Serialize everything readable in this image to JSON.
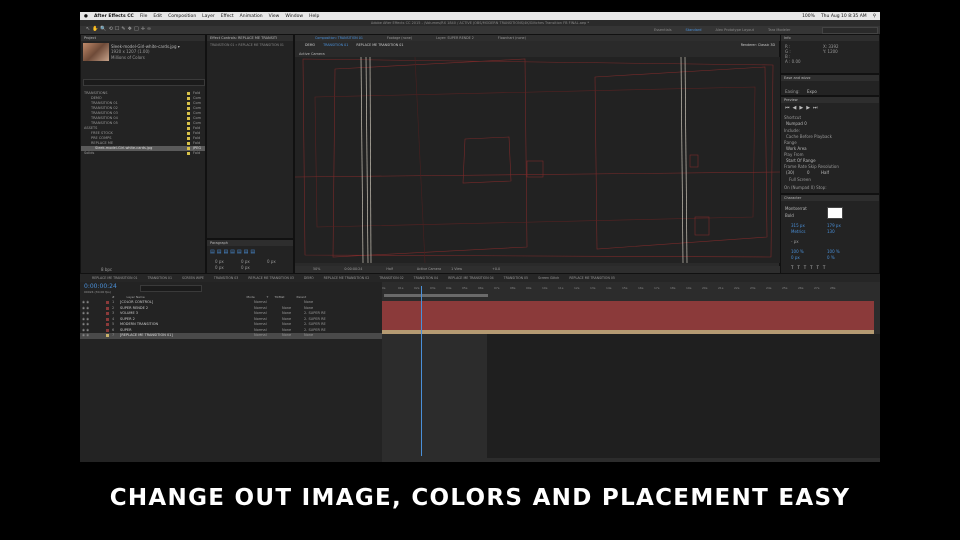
{
  "menu": [
    "After Effects CC",
    "File",
    "Edit",
    "Composition",
    "Layer",
    "Effect",
    "Animation",
    "View",
    "Window",
    "Help"
  ],
  "status": {
    "battery": "100%",
    "time": "Thu Aug 10  8:35 AM"
  },
  "window_title": "Adobe After Effects CC 2015 - /Volumes/RX 1840 / ACTIVE JOBS/MODERN TRANSITIONS/4K/Glitches Transition FB FINAL.aep *",
  "workspaces": [
    "Essentials",
    "Standard",
    "Alex Prototype Layout",
    "Tara Modeler"
  ],
  "project": {
    "title": "Project",
    "filename": "Sleek-model-Girl-white-cards.jpg ▾",
    "dims": "1920 x 1207 (1.00)",
    "colors": "Millions of Colors",
    "items": [
      {
        "name": "TRANSITIONS",
        "type": "Fold",
        "sel": false
      },
      {
        "name": "DEMO",
        "type": "Com",
        "sel": false
      },
      {
        "name": "TRANSITION 01",
        "type": "Com",
        "sel": false
      },
      {
        "name": "TRANSITION 02",
        "type": "Com",
        "sel": false
      },
      {
        "name": "TRANSITION 03",
        "type": "Com",
        "sel": false
      },
      {
        "name": "TRANSITION 04",
        "type": "Com",
        "sel": false
      },
      {
        "name": "TRANSITION 05",
        "type": "Com",
        "sel": false
      },
      {
        "name": "ASSETS",
        "type": "Fold",
        "sel": false
      },
      {
        "name": "FREE STOCK",
        "type": "Fold",
        "sel": false
      },
      {
        "name": "PRE COMPS",
        "type": "Fold",
        "sel": false
      },
      {
        "name": "REPLACE ME",
        "type": "Fold",
        "sel": false
      },
      {
        "name": "Sleek-model-Girl-white-cards.jpg",
        "type": "JPEG",
        "sel": true
      },
      {
        "name": "Solids",
        "type": "Fold",
        "sel": false
      }
    ],
    "footer": "8 bpc"
  },
  "effect_controls": {
    "title": "Effect Controls: REPLACE ME TRANSITI",
    "sub": "TRANSITION 01 » REPLACE ME TRANSITION 01"
  },
  "paragraph": {
    "title": "Paragraph",
    "vals": [
      "0 px",
      "0 px",
      "0 px",
      "0 px",
      "0 px"
    ]
  },
  "comp_tabs": [
    "Composition: TRANSITION 01",
    "Footage (none)",
    "Layer: SUPER RENDE 2",
    "Flowchart (none)"
  ],
  "comp_breadcrumb": [
    "DEMO",
    "TRANSITION 01",
    "REPLACE ME TRANSITION 01"
  ],
  "renderer": "Renderer:  Classic 3D",
  "active_camera": "Active Camera",
  "viewer_bar": {
    "zoom": "50%",
    "time": "0:00:00:24",
    "res": "Half",
    "cam": "Active Camera",
    "views": "1 View",
    "offset": "+0.0"
  },
  "info_panel": {
    "title": "Info",
    "lines": [
      "R :",
      "G :",
      "B :",
      "A : 0.00"
    ],
    "coords": [
      "X: 3392",
      "Y: 1200"
    ]
  },
  "right_panels": {
    "ease": "Ease and wizzz",
    "easing": "Easing:",
    "easing_val": "Expo",
    "preview": "Preview",
    "shortcut": "Shortcut",
    "shortcut_val": "Numpad 0",
    "include": "Include:",
    "cache": "Cache Before Playback",
    "range": "Range",
    "range_val": "Work Area",
    "playfrom": "Play From",
    "playfrom_val": "Start Of Range",
    "fps_lbl": "Frame Rate   Skip   Resolution",
    "fps": "(30)",
    "skip": "0",
    "resl": "Half",
    "fullscreen": "Full Screen",
    "ondrop": "On (Numpad 0) Stop:"
  },
  "character": {
    "title": "Character",
    "font": "Montserrat",
    "style": "Bold",
    "size": "315 px",
    "lead": "179 px",
    "kern": "Metrics",
    "track": "130",
    "stroke": "- px",
    "scale_v": "100 %",
    "scale_h": "100 %",
    "base": "0 px",
    "tsume": "0 %"
  },
  "timeline_tabs": [
    "REPLACE ME TRANSITION 01",
    "TRANSITION 01",
    "SCREEN WIPE",
    "TRANSITION 03",
    "REPLACE ME TRANSITION 03",
    "DEMO",
    "REPLACE ME TRANSITION 02",
    "TRANSITION 02",
    "TRANSITION 04",
    "REPLACE ME TRANSITION 04",
    "TRANSITION 05",
    "Screen Glitch",
    "REPLACE ME TRANSITION 05"
  ],
  "timecode": "0:00:00:24",
  "timecode_sub": "00024 (30.00 fps)",
  "layer_header": [
    "#",
    "Layer Name",
    "Mode",
    "T",
    "TrkMat",
    "Parent"
  ],
  "layers": [
    {
      "n": "1",
      "name": "[COLOR CONTROL]",
      "mode": "Normal",
      "trk": "",
      "parent": "None"
    },
    {
      "n": "2",
      "name": "SUPER RENDE 2",
      "mode": "Normal",
      "trk": "None",
      "parent": "None"
    },
    {
      "n": "3",
      "name": "VOLUME 3",
      "mode": "Normal",
      "trk": "None",
      "parent": "2. SUPER RE"
    },
    {
      "n": "4",
      "name": "SUPER 2",
      "mode": "Normal",
      "trk": "None",
      "parent": "2. SUPER RE"
    },
    {
      "n": "5",
      "name": "MODERN TRANSITION",
      "mode": "Normal",
      "trk": "None",
      "parent": "2. SUPER RE"
    },
    {
      "n": "6",
      "name": "SUPER",
      "mode": "Normal",
      "trk": "None",
      "parent": "2. SUPER RE"
    },
    {
      "n": "7",
      "name": "[REPLACE ME TRANSITION 01]",
      "mode": "Normal",
      "trk": "None",
      "parent": "None"
    }
  ],
  "ruler_ticks": [
    "0s",
    "01s",
    "02s",
    "03s",
    "04s",
    "05s",
    "06s",
    "07s",
    "08s",
    "09s",
    "10s",
    "11s",
    "12s",
    "13s",
    "14s",
    "15s",
    "16s",
    "17s",
    "18s",
    "19s",
    "20s",
    "21s",
    "22s",
    "23s",
    "24s",
    "25s",
    "26s",
    "27s",
    "28s"
  ],
  "caption": "CHANGE OUT IMAGE, COLORS AND PLACEMENT EASY",
  "colors": {
    "track_red": "#8b3a3a",
    "accent_blue": "#4a90d9",
    "caption": "#ffffff"
  }
}
